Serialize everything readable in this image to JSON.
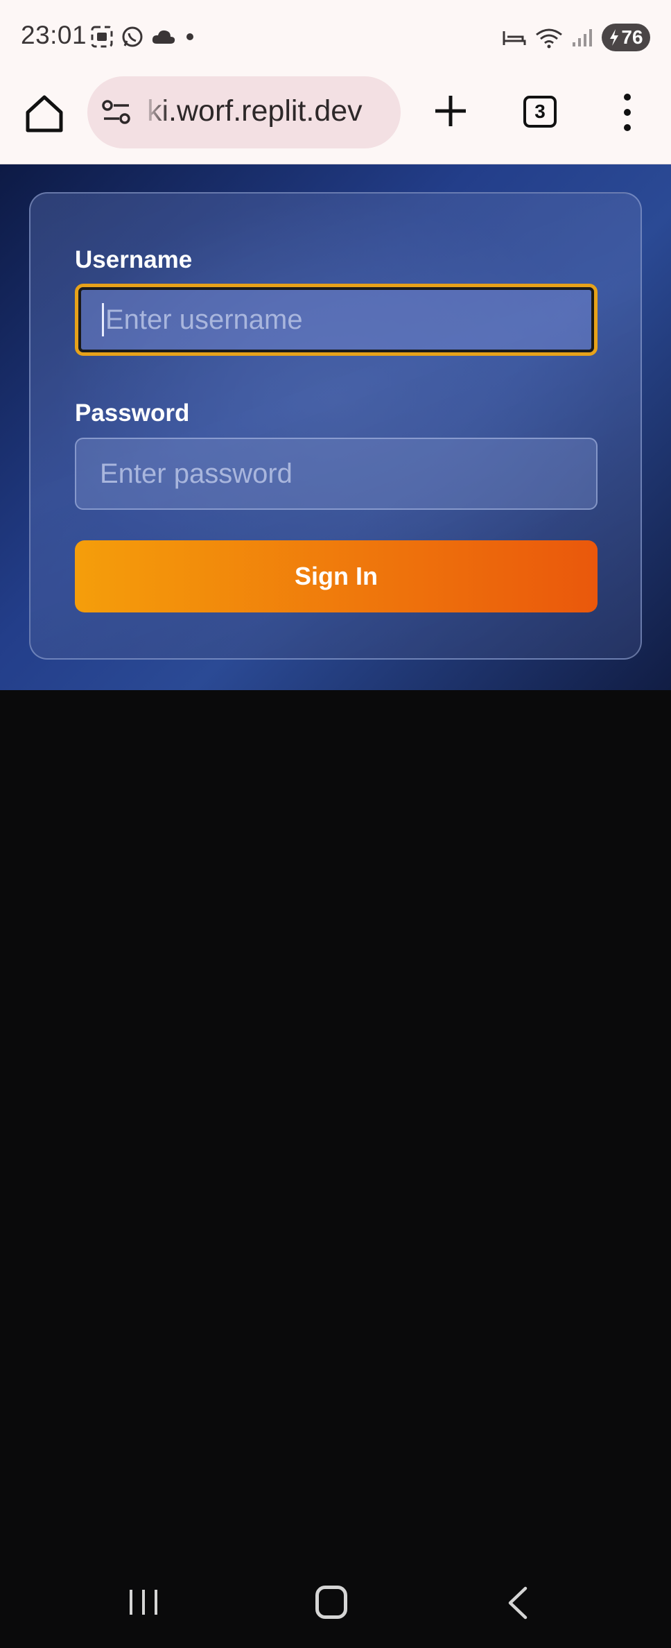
{
  "status_bar": {
    "time": "23:01",
    "left_icons": [
      "screenshot-icon",
      "whatsapp-icon",
      "cloud-icon",
      "dot-icon"
    ],
    "right_icons": [
      "sleep-icon",
      "wifi-icon",
      "signal-icon"
    ],
    "battery": "76"
  },
  "browser": {
    "url": "ki.worf.replit.dev",
    "tab_count": "3"
  },
  "login": {
    "username_label": "Username",
    "username_placeholder": "Enter username",
    "password_label": "Password",
    "password_placeholder": "Enter password",
    "signin_label": "Sign In"
  },
  "colors": {
    "accent_gradient_start": "#f59e0b",
    "accent_gradient_end": "#ea580c",
    "focus_ring": "#e7a21a",
    "page_background": "#0a0a0b"
  }
}
